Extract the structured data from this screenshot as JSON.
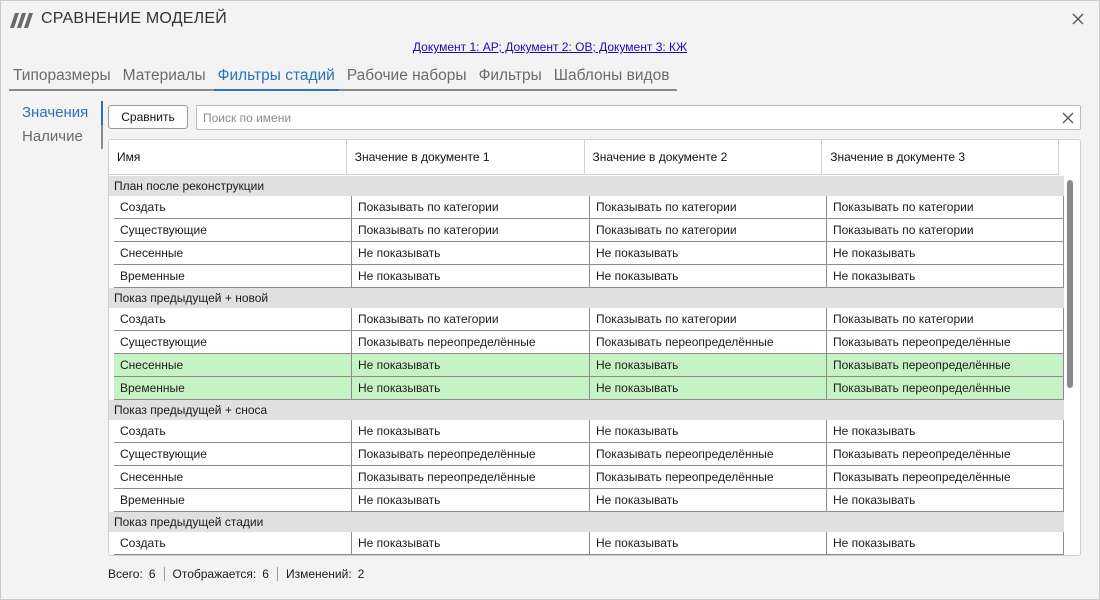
{
  "window": {
    "title": "СРАВНЕНИЕ МОДЕЛЕЙ"
  },
  "icons": {
    "logo": "app-logo-icon",
    "close": "close-icon",
    "clear": "clear-search-icon"
  },
  "colors": {
    "accent": "#2b73b8",
    "changed_row": "#c6f3c6",
    "group_row": "#e0e0e0"
  },
  "documents_link": "Документ 1: АР;  Документ 2: ОВ;  Документ 3: КЖ",
  "tabs": [
    {
      "label": "Типоразмеры",
      "active": false
    },
    {
      "label": "Материалы",
      "active": false
    },
    {
      "label": "Фильтры стадий",
      "active": true
    },
    {
      "label": "Рабочие наборы",
      "active": false
    },
    {
      "label": "Фильтры",
      "active": false
    },
    {
      "label": "Шаблоны видов",
      "active": false
    }
  ],
  "sidenav": [
    {
      "label": "Значения",
      "active": true
    },
    {
      "label": "Наличие",
      "active": false
    }
  ],
  "toolbar": {
    "compare_label": "Сравнить",
    "search_placeholder": "Поиск по имени",
    "search_value": ""
  },
  "table": {
    "columns": [
      "Имя",
      "Значение в документе 1",
      "Значение в документе 2",
      "Значение в документе 3"
    ],
    "groups": [
      {
        "name": "План после реконструкции",
        "rows": [
          {
            "cells": [
              "Создать",
              "Показывать по категории",
              "Показывать по категории",
              "Показывать по категории"
            ],
            "changed": false
          },
          {
            "cells": [
              "Существующие",
              "Показывать по категории",
              "Показывать по категории",
              "Показывать по категории"
            ],
            "changed": false
          },
          {
            "cells": [
              "Снесенные",
              "Не показывать",
              "Не показывать",
              "Не показывать"
            ],
            "changed": false
          },
          {
            "cells": [
              "Временные",
              "Не показывать",
              "Не показывать",
              "Не показывать"
            ],
            "changed": false
          }
        ]
      },
      {
        "name": "Показ предыдущей + новой",
        "rows": [
          {
            "cells": [
              "Создать",
              "Показывать по категории",
              "Показывать по категории",
              "Показывать по категории"
            ],
            "changed": false
          },
          {
            "cells": [
              "Существующие",
              "Показывать переопределённые",
              "Показывать переопределённые",
              "Показывать переопределённые"
            ],
            "changed": false
          },
          {
            "cells": [
              "Снесенные",
              "Не показывать",
              "Не показывать",
              "Показывать переопределённые"
            ],
            "changed": true
          },
          {
            "cells": [
              "Временные",
              "Не показывать",
              "Не показывать",
              "Показывать переопределённые"
            ],
            "changed": true
          }
        ]
      },
      {
        "name": "Показ предыдущей + сноса",
        "rows": [
          {
            "cells": [
              "Создать",
              "Не показывать",
              "Не показывать",
              "Не показывать"
            ],
            "changed": false
          },
          {
            "cells": [
              "Существующие",
              "Показывать переопределённые",
              "Показывать переопределённые",
              "Показывать переопределённые"
            ],
            "changed": false
          },
          {
            "cells": [
              "Снесенные",
              "Показывать переопределённые",
              "Показывать переопределённые",
              "Показывать переопределённые"
            ],
            "changed": false
          },
          {
            "cells": [
              "Временные",
              "Не показывать",
              "Не показывать",
              "Не показывать"
            ],
            "changed": false
          }
        ]
      },
      {
        "name": "Показ предыдущей стадии",
        "rows": [
          {
            "cells": [
              "Создать",
              "Не показывать",
              "Не показывать",
              "Не показывать"
            ],
            "changed": false
          }
        ]
      }
    ]
  },
  "status": {
    "total_label": "Всего:",
    "total": "6",
    "shown_label": "Отображается:",
    "shown": "6",
    "changes_label": "Изменений:",
    "changes": "2"
  }
}
